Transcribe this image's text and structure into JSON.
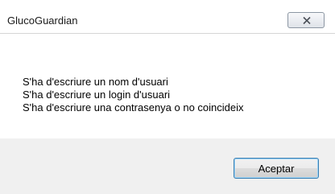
{
  "window": {
    "title": "GlucoGuardian",
    "close_icon": "close-x-icon"
  },
  "messages": [
    "S'ha d'escriure un nom d'usuari",
    "S'ha d'escriure un login d'usuari",
    "S'ha d'escriure una contrasenya o no coincideix"
  ],
  "buttons": {
    "accept_label": "Aceptar"
  }
}
